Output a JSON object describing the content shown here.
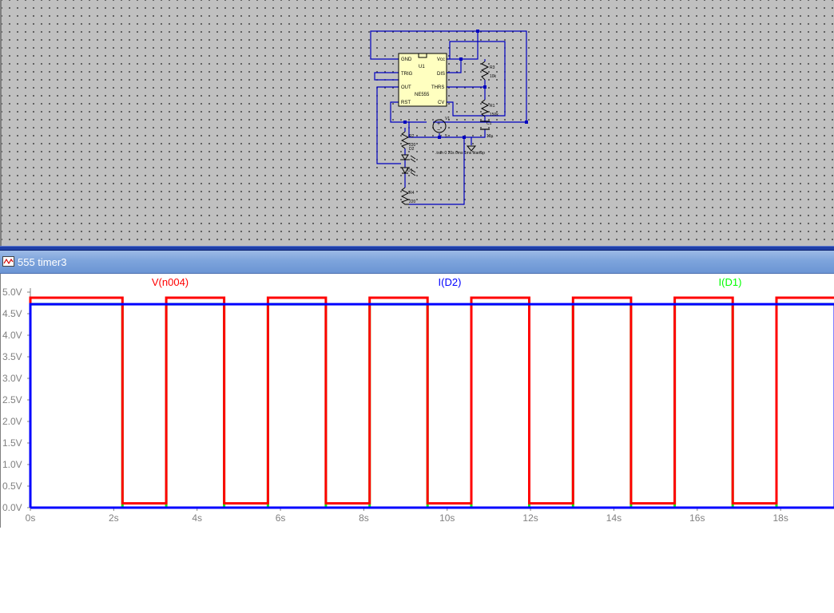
{
  "schematic": {
    "labels": {
      "ic_gnd": "GND",
      "ic_trig": "TRIG",
      "ic_out": "OUT",
      "ic_rst": "RST",
      "ic_vcc": "Vcc",
      "ic_dis": "DIS",
      "ic_thrs": "THRS",
      "ic_cv": "CV",
      "ic_ref": "U1",
      "ic_part": "NE555",
      "r3": "R3",
      "r3_val": "10k",
      "r1": "R1",
      "r1_val": "150k",
      "c1": "C1",
      "c1_val": "10µ",
      "r2": "R2",
      "r2_val": "220",
      "d2": "D2",
      "d1": "D1",
      "r4": "R4",
      "r4_val": "220",
      "v1": "V1",
      "v1_val": "5",
      "directive": ".tran 0 20s 0ms 1ms startup"
    }
  },
  "waveform_window": {
    "title": "555 timer3"
  },
  "chart_data": {
    "type": "line",
    "xlabel": "",
    "ylabel": "",
    "xlim": [
      0,
      19.3
    ],
    "ylim": [
      0,
      5.0
    ],
    "x_ticks": [
      "0s",
      "2s",
      "4s",
      "6s",
      "8s",
      "10s",
      "12s",
      "14s",
      "16s",
      "18s"
    ],
    "x_tick_values": [
      0,
      2,
      4,
      6,
      8,
      10,
      12,
      14,
      16,
      18
    ],
    "y_ticks": [
      "0.0V",
      "0.5V",
      "1.0V",
      "1.5V",
      "2.0V",
      "2.5V",
      "3.0V",
      "3.5V",
      "4.0V",
      "4.5V",
      "5.0V"
    ],
    "y_tick_values": [
      0,
      0.5,
      1.0,
      1.5,
      2.0,
      2.5,
      3.0,
      3.5,
      4.0,
      4.5,
      5.0
    ],
    "grid": false,
    "series": [
      {
        "name": "V(n004)",
        "color": "#ff0000",
        "x": [
          0,
          0,
          2.21,
          2.21,
          3.26,
          3.26,
          4.65,
          4.65,
          5.7,
          5.7,
          7.09,
          7.09,
          8.14,
          8.14,
          9.53,
          9.53,
          10.58,
          10.58,
          11.97,
          11.97,
          13.02,
          13.02,
          14.41,
          14.41,
          15.46,
          15.46,
          16.85,
          16.85,
          17.9,
          17.9,
          19.3
        ],
        "y": [
          0,
          4.87,
          4.87,
          0.1,
          0.1,
          4.87,
          4.87,
          0.1,
          0.1,
          4.87,
          4.87,
          0.1,
          0.1,
          4.87,
          4.87,
          0.1,
          0.1,
          4.87,
          4.87,
          0.1,
          0.1,
          4.87,
          4.87,
          0.1,
          0.1,
          4.87,
          4.87,
          0.1,
          0.1,
          4.87,
          4.87
        ]
      },
      {
        "name": "I(D2)",
        "color": "#0000ff",
        "x": [
          0,
          0,
          19.3,
          19.3,
          0
        ],
        "y": [
          0,
          4.72,
          4.72,
          0,
          0
        ]
      },
      {
        "name": "I(D1)",
        "color": "#00ff00",
        "x": [
          0,
          0,
          2.21,
          2.21,
          3.26,
          3.26,
          4.65,
          4.65,
          5.7,
          5.7,
          7.09,
          7.09,
          8.14,
          8.14,
          9.53,
          9.53,
          10.58,
          10.58,
          11.97,
          11.97,
          13.02,
          13.02,
          14.41,
          14.41,
          15.46,
          15.46,
          16.85,
          16.85,
          17.9,
          17.9,
          19.3
        ],
        "y": [
          0,
          4.72,
          4.72,
          0,
          0,
          4.72,
          4.72,
          0,
          0,
          4.72,
          4.72,
          0,
          0,
          4.72,
          4.72,
          0,
          0,
          4.72,
          4.72,
          0,
          0,
          4.72,
          4.72,
          0,
          0,
          4.72,
          4.72,
          0,
          0,
          4.72,
          4.72
        ]
      }
    ]
  }
}
